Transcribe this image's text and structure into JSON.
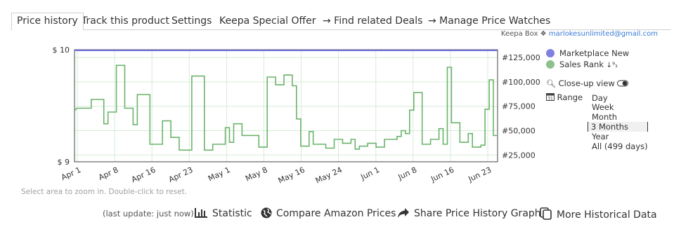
{
  "tabs": [
    {
      "label": "Price history",
      "active": true
    },
    {
      "label": "Track this product",
      "active": false
    },
    {
      "label": "Settings",
      "active": false
    },
    {
      "label": "Keepa Special Offer",
      "active": false
    },
    {
      "label": "→ Find related Deals",
      "active": false
    },
    {
      "label": "→ Manage Price Watches",
      "active": false
    }
  ],
  "account": {
    "box_label": "Keepa Box ❖",
    "email": "marlokesunlimited@gmail.com"
  },
  "legend": [
    {
      "label": "Marketplace New",
      "color": "#8080e0"
    },
    {
      "label": "Sales Rank",
      "color": "#8cc08c",
      "suffix": "↓⁹₁"
    }
  ],
  "options": {
    "closeup_label": "Close-up view",
    "range_label": "Range"
  },
  "range_items": [
    "Day",
    "Week",
    "Month",
    "3 Months",
    "Year",
    "All (499 days)"
  ],
  "range_selected": "3 Months",
  "hint": "Select area to zoom in. Double-click to reset.",
  "bottom": {
    "last_update": "(last update: just now)",
    "statistic": "Statistic",
    "compare": "Compare Amazon Prices",
    "share": "Share Price History Graph",
    "more": "More Historical Data"
  },
  "chart_data": {
    "type": "line",
    "x_labels": [
      "Apr 1",
      "Apr 8",
      "Apr 16",
      "Apr 23",
      "May 1",
      "May 8",
      "May 16",
      "May 24",
      "Jun 1",
      "Jun 8",
      "Jun 16",
      "Jun 23"
    ],
    "y_left_ticks": [
      "$ 10",
      "$ 9"
    ],
    "y_right_ticks": [
      "#125,000",
      "#100,000",
      "#75,000",
      "#50,000",
      "#25,000"
    ],
    "y_right_range": [
      18000,
      133000
    ],
    "series": [
      {
        "name": "Marketplace New",
        "color": "#7070e0",
        "values": [
          10,
          10
        ]
      },
      {
        "name": "Sales Rank",
        "color": "#6cb36c",
        "points": [
          [
            0,
            70000
          ],
          [
            0.5,
            73000
          ],
          [
            4,
            73000
          ],
          [
            4,
            82000
          ],
          [
            7,
            82000
          ],
          [
            7,
            57000
          ],
          [
            8,
            57000
          ],
          [
            8,
            69000
          ],
          [
            10,
            69000
          ],
          [
            10,
            117000
          ],
          [
            12,
            117000
          ],
          [
            12,
            73000
          ],
          [
            14,
            73000
          ],
          [
            14,
            56000
          ],
          [
            15,
            56000
          ],
          [
            15,
            87000
          ],
          [
            18,
            87000
          ],
          [
            18,
            36000
          ],
          [
            21,
            36000
          ],
          [
            21,
            60000
          ],
          [
            23,
            60000
          ],
          [
            23,
            43000
          ],
          [
            25,
            43000
          ],
          [
            25,
            30000
          ],
          [
            28,
            30000
          ],
          [
            28,
            106000
          ],
          [
            31,
            106000
          ],
          [
            31,
            30000
          ],
          [
            33,
            30000
          ],
          [
            33,
            36000
          ],
          [
            36,
            36000
          ],
          [
            36,
            53000
          ],
          [
            37,
            53000
          ],
          [
            37,
            38000
          ],
          [
            38,
            38000
          ],
          [
            38,
            57000
          ],
          [
            40,
            57000
          ],
          [
            40,
            45000
          ],
          [
            44,
            45000
          ],
          [
            44,
            33000
          ],
          [
            46,
            33000
          ],
          [
            46,
            105000
          ],
          [
            48,
            105000
          ],
          [
            48,
            97000
          ],
          [
            50,
            97000
          ],
          [
            50,
            107000
          ],
          [
            52,
            107000
          ],
          [
            52,
            96000
          ],
          [
            53,
            96000
          ],
          [
            53,
            62000
          ],
          [
            54,
            62000
          ],
          [
            54,
            34000
          ],
          [
            56,
            34000
          ],
          [
            56,
            49000
          ],
          [
            57,
            49000
          ],
          [
            57,
            36000
          ],
          [
            60,
            36000
          ],
          [
            60,
            32000
          ],
          [
            62,
            32000
          ],
          [
            62,
            41000
          ],
          [
            64,
            41000
          ],
          [
            64,
            37000
          ],
          [
            66,
            37000
          ],
          [
            66,
            41000
          ],
          [
            67,
            41000
          ],
          [
            67,
            31000
          ],
          [
            68,
            31000
          ],
          [
            68,
            34000
          ],
          [
            70,
            34000
          ],
          [
            70,
            37000
          ],
          [
            72,
            37000
          ],
          [
            72,
            33000
          ],
          [
            74,
            33000
          ],
          [
            74,
            41000
          ],
          [
            77,
            41000
          ],
          [
            77,
            44000
          ],
          [
            78,
            44000
          ],
          [
            78,
            50000
          ],
          [
            79,
            50000
          ],
          [
            79,
            47000
          ],
          [
            80,
            47000
          ],
          [
            80,
            71000
          ],
          [
            81,
            71000
          ],
          [
            81,
            89000
          ],
          [
            83,
            89000
          ],
          [
            83,
            36000
          ],
          [
            85,
            36000
          ],
          [
            85,
            41000
          ],
          [
            87,
            41000
          ],
          [
            87,
            52000
          ],
          [
            88,
            52000
          ],
          [
            88,
            36000
          ],
          [
            89,
            36000
          ],
          [
            89,
            115000
          ],
          [
            90,
            115000
          ],
          [
            90,
            58000
          ],
          [
            92,
            58000
          ],
          [
            92,
            38000
          ],
          [
            94,
            38000
          ],
          [
            94,
            47000
          ],
          [
            95,
            47000
          ],
          [
            95,
            33000
          ],
          [
            97,
            33000
          ],
          [
            97,
            35000
          ],
          [
            98,
            35000
          ],
          [
            98,
            72000
          ],
          [
            99,
            72000
          ],
          [
            99,
            102000
          ],
          [
            100,
            102000
          ],
          [
            100,
            45000
          ],
          [
            101,
            45000
          ]
        ]
      }
    ],
    "x_max": 101
  }
}
